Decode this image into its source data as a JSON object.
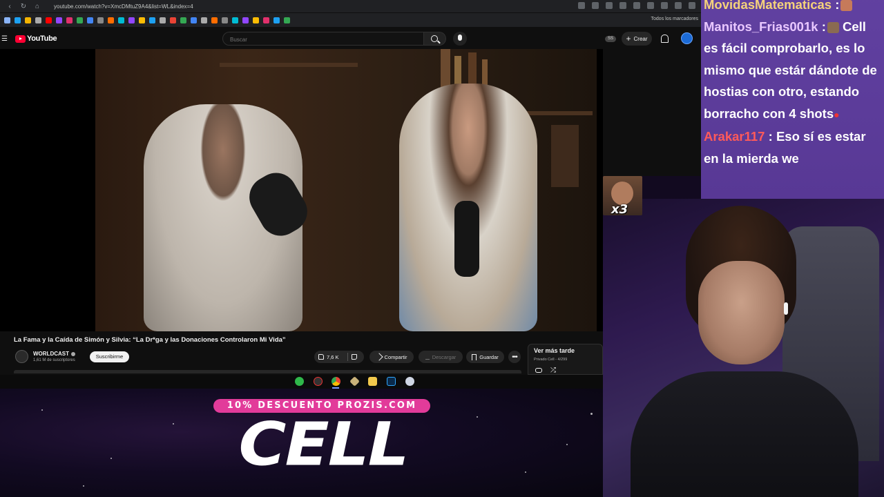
{
  "browser": {
    "url": "youtube.com/watch?v=XmcDMtuZ9A4&list=WL&index=4",
    "bookmarks_all": "Todos los marcadores"
  },
  "youtube": {
    "logo_text": "YouTube",
    "search_placeholder": "Buscar",
    "ss_badge": "SS",
    "create_label": "Crear"
  },
  "video": {
    "title": "La Fama y la Caída de Simón y Silvia: “La Dr*ga y las Donaciones Controlaron Mi Vida”",
    "channel_name": "WORLDCAST",
    "subscribers": "1,61 M de suscriptores",
    "subscribe_label": "Suscribirme",
    "likes": "7,6 K",
    "share_label": "Compartir",
    "download_label": "Descargar",
    "save_label": "Guardar",
    "more_label": "•••"
  },
  "playlist": {
    "title": "Ver más tarde",
    "meta": "Privado  Cell  - 4/299"
  },
  "chat": {
    "messages": [
      {
        "user": "MovidasMatematicas",
        "text": "",
        "user_color": "#f5d27a"
      },
      {
        "user": "Manitos_Frias001k",
        "text": "Cell es fácil comprobarlo, es lo mismo que estár dándote de hostias con otro, estando borracho con 4 shots",
        "user_color": "#e9c8ff"
      },
      {
        "user": "Arakar117",
        "text": "Eso sí es estar en la mierda we",
        "user_color": "#ff5a5a"
      }
    ]
  },
  "overlay": {
    "promo_banner": "10% DESCUENTO PROZIS.COM",
    "promo_word": "CELL",
    "emote_count": "x3"
  },
  "colors": {
    "youtube_red": "#ff0033",
    "promo_pink": "#e23b9a",
    "chat_bg": "#5b3a98"
  }
}
